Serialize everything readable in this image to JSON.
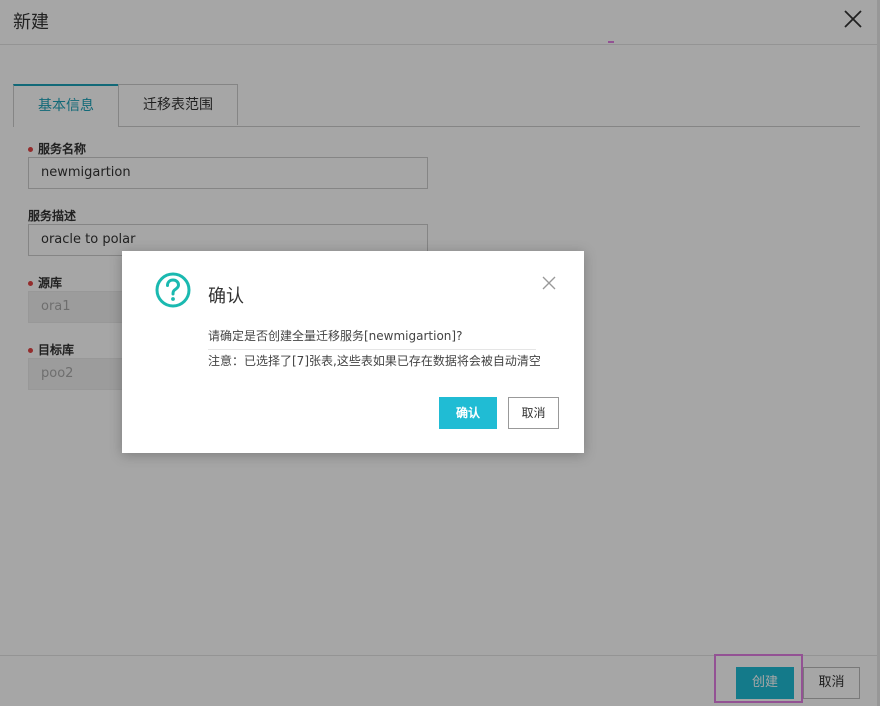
{
  "modal": {
    "title": "新建",
    "tabs": [
      {
        "label": "基本信息",
        "active": true
      },
      {
        "label": "迁移表范围",
        "active": false
      }
    ],
    "fields": [
      {
        "label": "服务名称",
        "required": true,
        "value": "newmigartion",
        "disabled": false
      },
      {
        "label": "服务描述",
        "required": false,
        "value": "oracle to polar",
        "disabled": false
      },
      {
        "label": "源库",
        "required": true,
        "value": "ora1",
        "disabled": true
      },
      {
        "label": "目标库",
        "required": true,
        "value": "poo2",
        "disabled": true
      }
    ],
    "footer": {
      "create_label": "创建",
      "cancel_label": "取消"
    }
  },
  "dialog": {
    "title": "确认",
    "message": "请确定是否创建全量迁移服务[newmigartion]?",
    "note": "注意：已选择了[7]张表,这些表如果已存在数据将会被自动清空",
    "confirm_label": "确认",
    "cancel_label": "取消"
  },
  "colors": {
    "accent": "#20bcd4",
    "tab_active": "#1ca2b8",
    "required": "#e24444",
    "highlight": "#e27ee3"
  },
  "icons": {
    "close": "close-icon",
    "question": "question-circle-icon"
  }
}
